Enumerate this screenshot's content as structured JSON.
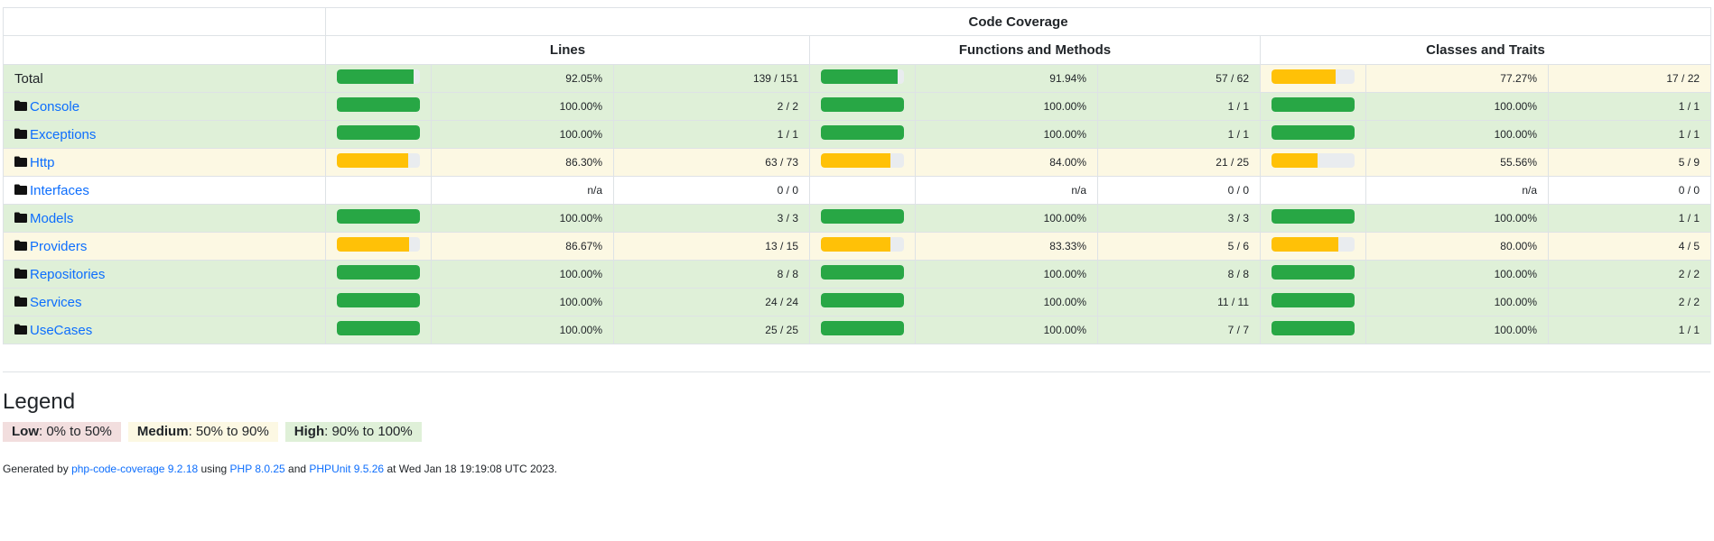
{
  "header": {
    "title": "Code Coverage",
    "columns": [
      "Lines",
      "Functions and Methods",
      "Classes and Traits"
    ]
  },
  "colors": {
    "high_bg": "#dff0d8",
    "medium_bg": "#fcf8e3",
    "low_bg": "#f2dede",
    "bar_high": "#28a745",
    "bar_medium": "#ffc107",
    "bar_track": "#e9ecef",
    "link": "#0d6efd"
  },
  "rows": [
    {
      "name": "Total",
      "is_total": true,
      "icon": "",
      "lines": {
        "pct": 92.05,
        "pct_text": "92.05%",
        "count": "139 / 151"
      },
      "functions": {
        "pct": 91.94,
        "pct_text": "91.94%",
        "count": "57 / 62"
      },
      "classes": {
        "pct": 77.27,
        "pct_text": "77.27%",
        "count": "17 / 22"
      }
    },
    {
      "name": "Console",
      "is_total": false,
      "icon": "folder-icon",
      "lines": {
        "pct": 100,
        "pct_text": "100.00%",
        "count": "2 / 2"
      },
      "functions": {
        "pct": 100,
        "pct_text": "100.00%",
        "count": "1 / 1"
      },
      "classes": {
        "pct": 100,
        "pct_text": "100.00%",
        "count": "1 / 1"
      }
    },
    {
      "name": "Exceptions",
      "is_total": false,
      "icon": "folder-icon",
      "lines": {
        "pct": 100,
        "pct_text": "100.00%",
        "count": "1 / 1"
      },
      "functions": {
        "pct": 100,
        "pct_text": "100.00%",
        "count": "1 / 1"
      },
      "classes": {
        "pct": 100,
        "pct_text": "100.00%",
        "count": "1 / 1"
      }
    },
    {
      "name": "Http",
      "is_total": false,
      "icon": "folder-icon",
      "lines": {
        "pct": 86.3,
        "pct_text": "86.30%",
        "count": "63 / 73"
      },
      "functions": {
        "pct": 84.0,
        "pct_text": "84.00%",
        "count": "21 / 25"
      },
      "classes": {
        "pct": 55.56,
        "pct_text": "55.56%",
        "count": "5 / 9"
      }
    },
    {
      "name": "Interfaces",
      "is_total": false,
      "icon": "folder-icon",
      "lines": {
        "pct": null,
        "pct_text": "n/a",
        "count": "0 / 0"
      },
      "functions": {
        "pct": null,
        "pct_text": "n/a",
        "count": "0 / 0"
      },
      "classes": {
        "pct": null,
        "pct_text": "n/a",
        "count": "0 / 0"
      }
    },
    {
      "name": "Models",
      "is_total": false,
      "icon": "folder-icon",
      "lines": {
        "pct": 100,
        "pct_text": "100.00%",
        "count": "3 / 3"
      },
      "functions": {
        "pct": 100,
        "pct_text": "100.00%",
        "count": "3 / 3"
      },
      "classes": {
        "pct": 100,
        "pct_text": "100.00%",
        "count": "1 / 1"
      }
    },
    {
      "name": "Providers",
      "is_total": false,
      "icon": "folder-icon",
      "lines": {
        "pct": 86.67,
        "pct_text": "86.67%",
        "count": "13 / 15"
      },
      "functions": {
        "pct": 83.33,
        "pct_text": "83.33%",
        "count": "5 / 6"
      },
      "classes": {
        "pct": 80.0,
        "pct_text": "80.00%",
        "count": "4 / 5"
      }
    },
    {
      "name": "Repositories",
      "is_total": false,
      "icon": "folder-icon",
      "lines": {
        "pct": 100,
        "pct_text": "100.00%",
        "count": "8 / 8"
      },
      "functions": {
        "pct": 100,
        "pct_text": "100.00%",
        "count": "8 / 8"
      },
      "classes": {
        "pct": 100,
        "pct_text": "100.00%",
        "count": "2 / 2"
      }
    },
    {
      "name": "Services",
      "is_total": false,
      "icon": "folder-icon",
      "lines": {
        "pct": 100,
        "pct_text": "100.00%",
        "count": "24 / 24"
      },
      "functions": {
        "pct": 100,
        "pct_text": "100.00%",
        "count": "11 / 11"
      },
      "classes": {
        "pct": 100,
        "pct_text": "100.00%",
        "count": "2 / 2"
      }
    },
    {
      "name": "UseCases",
      "is_total": false,
      "icon": "folder-icon",
      "lines": {
        "pct": 100,
        "pct_text": "100.00%",
        "count": "25 / 25"
      },
      "functions": {
        "pct": 100,
        "pct_text": "100.00%",
        "count": "7 / 7"
      },
      "classes": {
        "pct": 100,
        "pct_text": "100.00%",
        "count": "1 / 1"
      }
    }
  ],
  "legend": {
    "title": "Legend",
    "low_label": "Low",
    "low_range": ": 0% to 50%",
    "medium_label": "Medium",
    "medium_range": ": 50% to 90%",
    "high_label": "High",
    "high_range": ": 90% to 100%"
  },
  "footer": {
    "prefix": "Generated by ",
    "tool_link": "php-code-coverage 9.2.18",
    "using": " using ",
    "php_link": "PHP 8.0.25",
    "and": " and ",
    "phpunit_link": "PHPUnit 9.5.26",
    "suffix": " at Wed Jan 18 19:19:08 UTC 2023."
  }
}
